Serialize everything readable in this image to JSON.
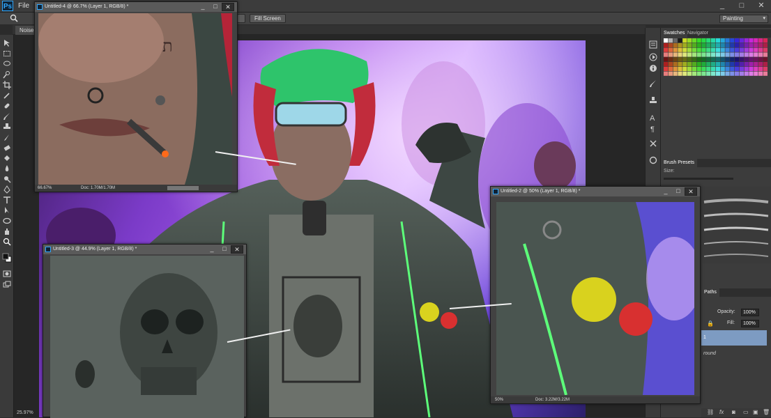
{
  "app": {
    "logo": "Ps",
    "menu": [
      "File"
    ],
    "window_controls": [
      "_",
      "□",
      "✕"
    ]
  },
  "options_bar": {
    "fill_screen_label": "Fill Screen",
    "workspace": "Painting"
  },
  "document_tab": {
    "label": "Noise."
  },
  "status": {
    "zoom": "25.97%"
  },
  "windows": {
    "w4": {
      "title": "Untitled-4 @ 66.7% (Layer 1, RGB/8) *",
      "zoom": "66.67%",
      "doc": "Doc: 1.70M/1.70M"
    },
    "w3": {
      "title": "Untitled-3 @ 44.9% (Layer 1, RGB/8) *"
    },
    "w2": {
      "title": "Untitled-2 @ 50% (Layer 1, RGB/8) *",
      "zoom": "50%",
      "doc": "Doc: 3.22M/3.22M"
    }
  },
  "panels": {
    "swatches_tab": "Swatches",
    "navigator_tab": "Navigator",
    "brush_presets_tab": "Brush Presets",
    "size_label": "Size:",
    "paths_tab": "Paths",
    "opacity_label": "Opacity:",
    "opacity_value": "100%",
    "fill_label": "Fill:",
    "fill_value": "100%",
    "layer1_label": "1",
    "background_label": "round"
  },
  "colors": {
    "accent": "#31a8ff",
    "selected_layer": "#7d9bc2"
  }
}
